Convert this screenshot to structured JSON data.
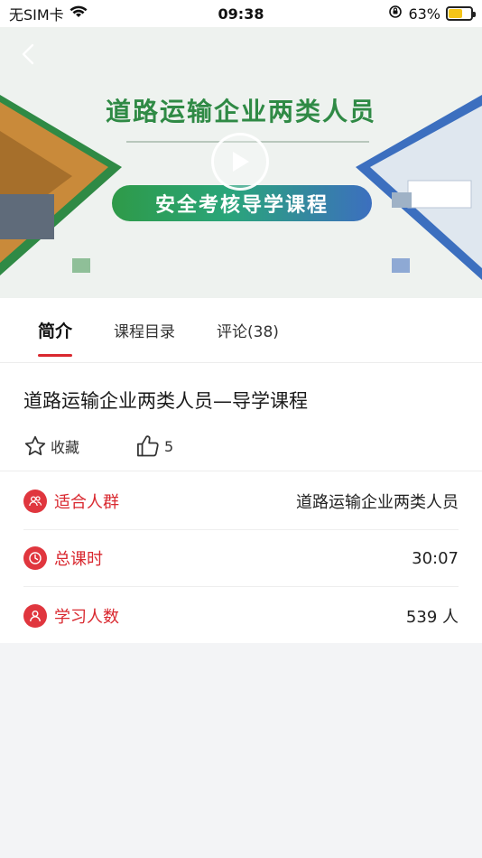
{
  "status_bar": {
    "carrier": "无SIM卡",
    "time": "09:38",
    "battery_percent": "63%",
    "battery_level": 0.63
  },
  "banner": {
    "title": "道路运输企业两类人员",
    "subtitle": "安全考核导学课程"
  },
  "tabs": [
    {
      "label": "简介",
      "active": true
    },
    {
      "label": "课程目录",
      "active": false
    },
    {
      "label": "评论(38)",
      "active": false
    }
  ],
  "course": {
    "title": "道路运输企业两类人员—导学课程",
    "favorite_label": "收藏",
    "like_count": "5"
  },
  "info": [
    {
      "label": "适合人群",
      "value": "道路运输企业两类人员",
      "icon": "people-icon"
    },
    {
      "label": "总课时",
      "value": "30:07",
      "icon": "clock-icon"
    },
    {
      "label": "学习人数",
      "value": "539 人",
      "icon": "user-icon"
    }
  ],
  "colors": {
    "accent": "#d9282f",
    "icon_bg": "#e0363e",
    "banner_green": "#2f8a45",
    "banner_blue": "#3c6fbf"
  }
}
